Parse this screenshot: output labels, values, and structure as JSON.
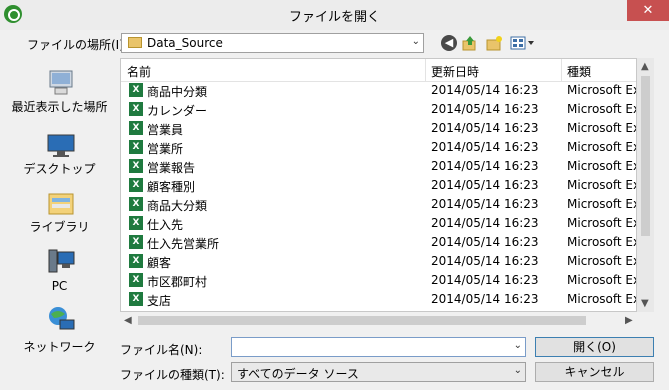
{
  "window": {
    "title": "ファイルを開く",
    "close_glyph": "✕"
  },
  "location": {
    "label": "ファイルの場所(I):",
    "value": "Data_Source",
    "arrow": "⌄"
  },
  "toolbar": {
    "back_glyph": "◀"
  },
  "places": [
    {
      "label": "最近表示した場所",
      "icon": "recent-places-icon"
    },
    {
      "label": "デスクトップ",
      "icon": "desktop-icon"
    },
    {
      "label": "ライブラリ",
      "icon": "library-icon"
    },
    {
      "label": "PC",
      "icon": "pc-icon"
    },
    {
      "label": "ネットワーク",
      "icon": "network-icon"
    }
  ],
  "columns": {
    "name": "名前",
    "date": "更新日時",
    "type": "種類"
  },
  "files": [
    {
      "name": "商品中分類",
      "date": "2014/05/14 16:23",
      "type": "Microsoft Ex"
    },
    {
      "name": "カレンダー",
      "date": "2014/05/14 16:23",
      "type": "Microsoft Ex"
    },
    {
      "name": "営業員",
      "date": "2014/05/14 16:23",
      "type": "Microsoft Ex"
    },
    {
      "name": "営業所",
      "date": "2014/05/14 16:23",
      "type": "Microsoft Ex"
    },
    {
      "name": "営業報告",
      "date": "2014/05/14 16:23",
      "type": "Microsoft Ex"
    },
    {
      "name": "顧客種別",
      "date": "2014/05/14 16:23",
      "type": "Microsoft Ex"
    },
    {
      "name": "商品大分類",
      "date": "2014/05/14 16:23",
      "type": "Microsoft Ex"
    },
    {
      "name": "仕入先",
      "date": "2014/05/14 16:23",
      "type": "Microsoft Ex"
    },
    {
      "name": "仕入先営業所",
      "date": "2014/05/14 16:23",
      "type": "Microsoft Ex"
    },
    {
      "name": "顧客",
      "date": "2014/05/14 16:23",
      "type": "Microsoft Ex"
    },
    {
      "name": "市区郡町村",
      "date": "2014/05/14 16:23",
      "type": "Microsoft Ex"
    },
    {
      "name": "支店",
      "date": "2014/05/14 16:23",
      "type": "Microsoft Ex"
    }
  ],
  "filename": {
    "label": "ファイル名(N):",
    "value": "",
    "arrow": "⌄"
  },
  "filetype": {
    "label": "ファイルの種類(T):",
    "value": "すべてのデータ ソース",
    "arrow": "⌄"
  },
  "buttons": {
    "open": "開く(O)",
    "cancel": "キャンセル"
  },
  "scroll_glyphs": {
    "left": "◀",
    "right": "▶",
    "up": "▲",
    "down": "▼"
  },
  "colors": {
    "close": "#c75050",
    "excel": "#1f7a3f",
    "folder": "#e9c46a"
  }
}
